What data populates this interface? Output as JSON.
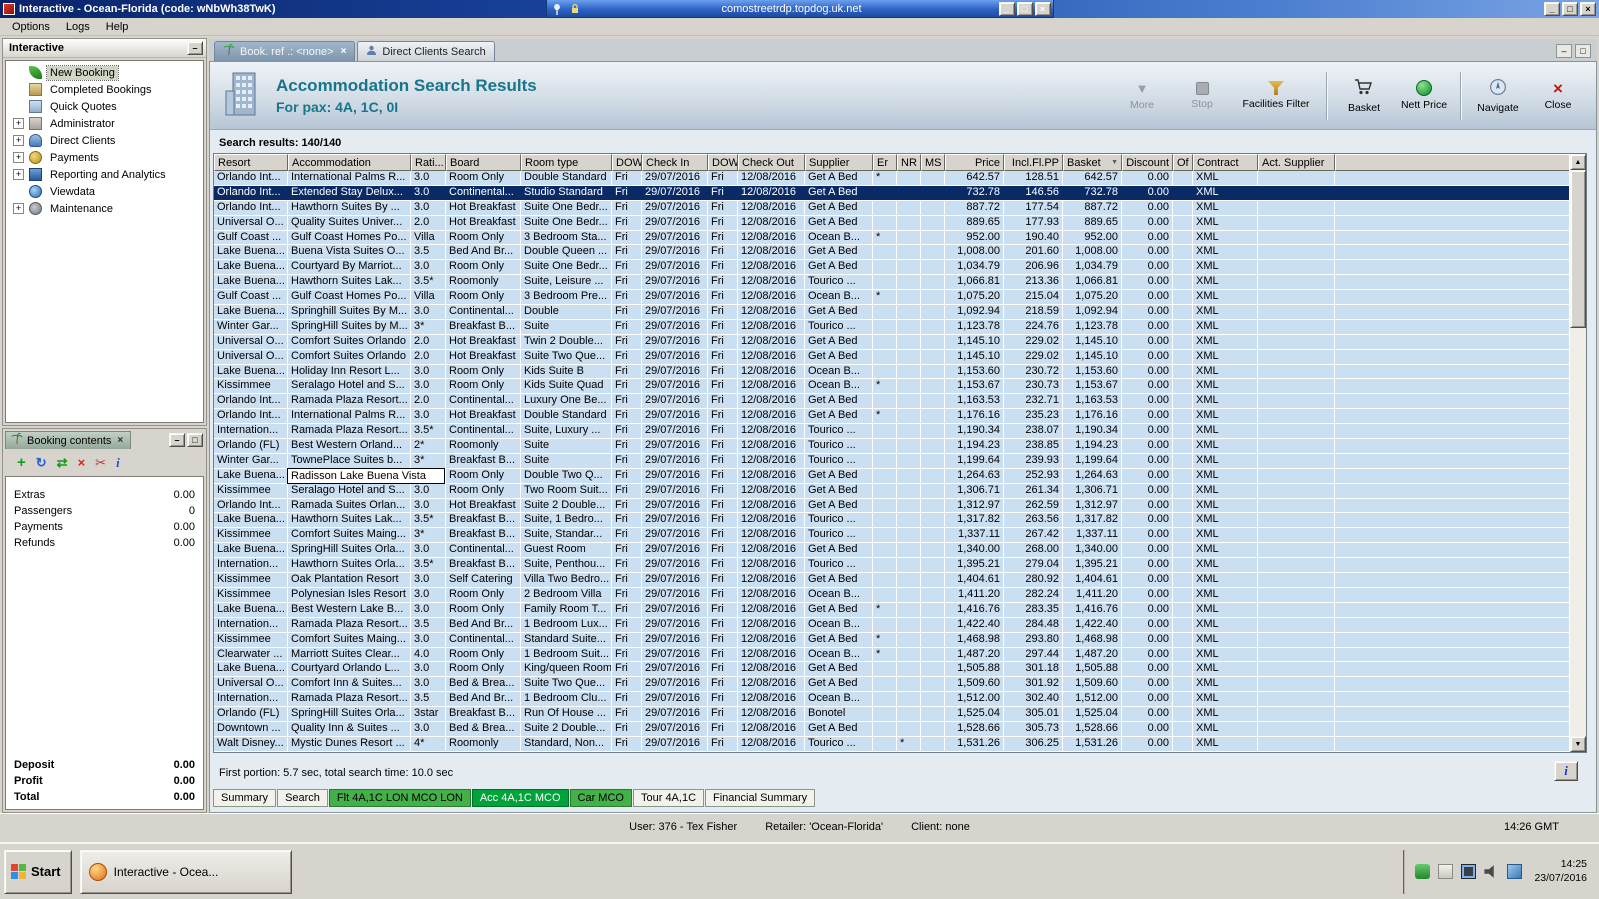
{
  "icons": {
    "minimize": "_",
    "maximize": "□",
    "close": "×",
    "collapse": "–",
    "expand": "+",
    "sort": "▼",
    "more": "▼",
    "up": "▲",
    "down": "▼",
    "plus": "+",
    "refresh": "↻",
    "transfer": "⇄",
    "delete": "×",
    "cut": "✂",
    "info": "i"
  },
  "rdp": {
    "host": "comostreetrdp.topdog.uk.net"
  },
  "window": {
    "title": "Interactive - Ocean-Florida (code: wNbWh38TwK)"
  },
  "menu": {
    "items": [
      "Options",
      "Logs",
      "Help"
    ]
  },
  "sidebar": {
    "title": "Interactive",
    "items": [
      {
        "label": "New Booking",
        "selected": true
      },
      {
        "label": "Completed Bookings"
      },
      {
        "label": "Quick Quotes"
      },
      {
        "label": "Administrator",
        "expandable": true
      },
      {
        "label": "Direct Clients",
        "expandable": true
      },
      {
        "label": "Payments",
        "expandable": true
      },
      {
        "label": "Reporting and Analytics",
        "expandable": true
      },
      {
        "label": "Viewdata"
      },
      {
        "label": "Maintenance",
        "expandable": true
      }
    ]
  },
  "booking_contents": {
    "title": "Booking contents",
    "rows": [
      {
        "label": "Extras",
        "value": "0.00"
      },
      {
        "label": "Passengers",
        "value": "0"
      },
      {
        "label": "Payments",
        "value": "0.00"
      },
      {
        "label": "Refunds",
        "value": "0.00"
      }
    ],
    "totals": [
      {
        "label": "Deposit",
        "value": "0.00"
      },
      {
        "label": "Profit",
        "value": "0.00"
      },
      {
        "label": "Total",
        "value": "0.00"
      }
    ]
  },
  "tabs": [
    {
      "label": "Book. ref .: <none>",
      "active": true
    },
    {
      "label": "Direct Clients Search",
      "active": false
    }
  ],
  "header": {
    "title": "Accommodation Search Results",
    "subtitle": "For pax: 4A, 1C, 0I",
    "buttons": [
      "More",
      "Stop",
      "Facilities Filter",
      "Basket",
      "Nett Price",
      "Navigate",
      "Close"
    ]
  },
  "results": {
    "summary": "Search results: 140/140",
    "footer": "First portion: 5.7 sec, total search time: 10.0 sec",
    "selected_index": 1,
    "edit_row_index": 20,
    "columns": [
      "Resort",
      "Accommodation",
      "Rati...",
      "Board",
      "Room type",
      "DOW",
      "Check In",
      "DOW",
      "Check Out",
      "Supplier",
      "Er",
      "NR",
      "MS",
      "Price",
      "Incl.Fl.PP",
      "Basket",
      "Discount",
      "Of",
      "Contract",
      "Act. Supplier"
    ],
    "rows": [
      [
        "Orlando Int...",
        "International Palms R...",
        "3.0",
        "Room Only",
        "Double Standard",
        "Fri",
        "29/07/2016",
        "Fri",
        "12/08/2016",
        "Get A Bed",
        "*",
        "",
        "",
        "642.57",
        "128.51",
        "642.57",
        "0.00",
        "",
        "XML",
        ""
      ],
      [
        "Orlando Int...",
        "Extended Stay Delux...",
        "3.0",
        "Continental...",
        "Studio Standard",
        "Fri",
        "29/07/2016",
        "Fri",
        "12/08/2016",
        "Get A Bed",
        "",
        "",
        "",
        "732.78",
        "146.56",
        "732.78",
        "0.00",
        "",
        "XML",
        ""
      ],
      [
        "Orlando Int...",
        "Hawthorn Suites By ...",
        "3.0",
        "Hot Breakfast",
        "Suite One Bedr...",
        "Fri",
        "29/07/2016",
        "Fri",
        "12/08/2016",
        "Get A Bed",
        "",
        "",
        "",
        "887.72",
        "177.54",
        "887.72",
        "0.00",
        "",
        "XML",
        ""
      ],
      [
        "Universal O...",
        "Quality Suites Univer...",
        "2.0",
        "Hot Breakfast",
        "Suite One Bedr...",
        "Fri",
        "29/07/2016",
        "Fri",
        "12/08/2016",
        "Get A Bed",
        "",
        "",
        "",
        "889.65",
        "177.93",
        "889.65",
        "0.00",
        "",
        "XML",
        ""
      ],
      [
        "Gulf Coast ...",
        "Gulf Coast Homes Po...",
        "Villa",
        "Room Only",
        "3 Bedroom Sta...",
        "Fri",
        "29/07/2016",
        "Fri",
        "12/08/2016",
        "Ocean B...",
        "*",
        "",
        "",
        "952.00",
        "190.40",
        "952.00",
        "0.00",
        "",
        "XML",
        ""
      ],
      [
        "Lake Buena...",
        "Buena Vista Suites O...",
        "3.5",
        "Bed And Br...",
        "Double Queen ...",
        "Fri",
        "29/07/2016",
        "Fri",
        "12/08/2016",
        "Get A Bed",
        "",
        "",
        "",
        "1,008.00",
        "201.60",
        "1,008.00",
        "0.00",
        "",
        "XML",
        ""
      ],
      [
        "Lake Buena...",
        "Courtyard By Marriot...",
        "3.0",
        "Room Only",
        "Suite One Bedr...",
        "Fri",
        "29/07/2016",
        "Fri",
        "12/08/2016",
        "Get A Bed",
        "",
        "",
        "",
        "1,034.79",
        "206.96",
        "1,034.79",
        "0.00",
        "",
        "XML",
        ""
      ],
      [
        "Lake Buena...",
        "Hawthorn Suites Lak...",
        "3.5*",
        "Roomonly",
        "Suite, Leisure ...",
        "Fri",
        "29/07/2016",
        "Fri",
        "12/08/2016",
        "Tourico ...",
        "",
        "",
        "",
        "1,066.81",
        "213.36",
        "1,066.81",
        "0.00",
        "",
        "XML",
        ""
      ],
      [
        "Gulf Coast ...",
        "Gulf Coast Homes Po...",
        "Villa",
        "Room Only",
        "3 Bedroom Pre...",
        "Fri",
        "29/07/2016",
        "Fri",
        "12/08/2016",
        "Ocean B...",
        "*",
        "",
        "",
        "1,075.20",
        "215.04",
        "1,075.20",
        "0.00",
        "",
        "XML",
        ""
      ],
      [
        "Lake Buena...",
        "Springhill Suites By M...",
        "3.0",
        "Continental...",
        "Double",
        "Fri",
        "29/07/2016",
        "Fri",
        "12/08/2016",
        "Get A Bed",
        "",
        "",
        "",
        "1,092.94",
        "218.59",
        "1,092.94",
        "0.00",
        "",
        "XML",
        ""
      ],
      [
        "Winter Gar...",
        "SpringHill Suites by M...",
        "3*",
        "Breakfast B...",
        "Suite",
        "Fri",
        "29/07/2016",
        "Fri",
        "12/08/2016",
        "Tourico ...",
        "",
        "",
        "",
        "1,123.78",
        "224.76",
        "1,123.78",
        "0.00",
        "",
        "XML",
        ""
      ],
      [
        "Universal O...",
        "Comfort Suites Orlando",
        "2.0",
        "Hot Breakfast",
        "Twin 2 Double...",
        "Fri",
        "29/07/2016",
        "Fri",
        "12/08/2016",
        "Get A Bed",
        "",
        "",
        "",
        "1,145.10",
        "229.02",
        "1,145.10",
        "0.00",
        "",
        "XML",
        ""
      ],
      [
        "Universal O...",
        "Comfort Suites Orlando",
        "2.0",
        "Hot Breakfast",
        "Suite Two Que...",
        "Fri",
        "29/07/2016",
        "Fri",
        "12/08/2016",
        "Get A Bed",
        "",
        "",
        "",
        "1,145.10",
        "229.02",
        "1,145.10",
        "0.00",
        "",
        "XML",
        ""
      ],
      [
        "Lake Buena...",
        "Holiday Inn Resort L...",
        "3.0",
        "Room Only",
        "Kids Suite B",
        "Fri",
        "29/07/2016",
        "Fri",
        "12/08/2016",
        "Ocean B...",
        "",
        "",
        "",
        "1,153.60",
        "230.72",
        "1,153.60",
        "0.00",
        "",
        "XML",
        ""
      ],
      [
        "Kissimmee",
        "Seralago Hotel and S...",
        "3.0",
        "Room Only",
        "Kids Suite Quad",
        "Fri",
        "29/07/2016",
        "Fri",
        "12/08/2016",
        "Ocean B...",
        "*",
        "",
        "",
        "1,153.67",
        "230.73",
        "1,153.67",
        "0.00",
        "",
        "XML",
        ""
      ],
      [
        "Orlando Int...",
        "Ramada Plaza Resort...",
        "2.0",
        "Continental...",
        "Luxury One Be...",
        "Fri",
        "29/07/2016",
        "Fri",
        "12/08/2016",
        "Get A Bed",
        "",
        "",
        "",
        "1,163.53",
        "232.71",
        "1,163.53",
        "0.00",
        "",
        "XML",
        ""
      ],
      [
        "Orlando Int...",
        "International Palms R...",
        "3.0",
        "Hot Breakfast",
        "Double Standard",
        "Fri",
        "29/07/2016",
        "Fri",
        "12/08/2016",
        "Get A Bed",
        "*",
        "",
        "",
        "1,176.16",
        "235.23",
        "1,176.16",
        "0.00",
        "",
        "XML",
        ""
      ],
      [
        "Internation...",
        "Ramada Plaza Resort...",
        "3.5*",
        "Continental...",
        "Suite, Luxury ...",
        "Fri",
        "29/07/2016",
        "Fri",
        "12/08/2016",
        "Tourico ...",
        "",
        "",
        "",
        "1,190.34",
        "238.07",
        "1,190.34",
        "0.00",
        "",
        "XML",
        ""
      ],
      [
        "Orlando (FL)",
        "Best Western Orland...",
        "2*",
        "Roomonly",
        "Suite",
        "Fri",
        "29/07/2016",
        "Fri",
        "12/08/2016",
        "Tourico ...",
        "",
        "",
        "",
        "1,194.23",
        "238.85",
        "1,194.23",
        "0.00",
        "",
        "XML",
        ""
      ],
      [
        "Winter Gar...",
        "TownePlace Suites b...",
        "3*",
        "Breakfast B...",
        "Suite",
        "Fri",
        "29/07/2016",
        "Fri",
        "12/08/2016",
        "Tourico ...",
        "",
        "",
        "",
        "1,199.64",
        "239.93",
        "1,199.64",
        "0.00",
        "",
        "XML",
        ""
      ],
      [
        "Lake Buena...",
        "Radisson Lake Buena Vista",
        "",
        "Room Only",
        "Double Two Q...",
        "Fri",
        "29/07/2016",
        "Fri",
        "12/08/2016",
        "Get A Bed",
        "",
        "",
        "",
        "1,264.63",
        "252.93",
        "1,264.63",
        "0.00",
        "",
        "XML",
        ""
      ],
      [
        "Kissimmee",
        "Seralago Hotel and S...",
        "3.0",
        "Room Only",
        "Two Room Suit...",
        "Fri",
        "29/07/2016",
        "Fri",
        "12/08/2016",
        "Get A Bed",
        "",
        "",
        "",
        "1,306.71",
        "261.34",
        "1,306.71",
        "0.00",
        "",
        "XML",
        ""
      ],
      [
        "Orlando Int...",
        "Ramada Suites Orlan...",
        "3.0",
        "Hot Breakfast",
        "Suite 2 Double...",
        "Fri",
        "29/07/2016",
        "Fri",
        "12/08/2016",
        "Get A Bed",
        "",
        "",
        "",
        "1,312.97",
        "262.59",
        "1,312.97",
        "0.00",
        "",
        "XML",
        ""
      ],
      [
        "Lake Buena...",
        "Hawthorn Suites Lak...",
        "3.5*",
        "Breakfast B...",
        "Suite, 1 Bedro...",
        "Fri",
        "29/07/2016",
        "Fri",
        "12/08/2016",
        "Tourico ...",
        "",
        "",
        "",
        "1,317.82",
        "263.56",
        "1,317.82",
        "0.00",
        "",
        "XML",
        ""
      ],
      [
        "Kissimmee",
        "Comfort Suites Maing...",
        "3*",
        "Breakfast B...",
        "Suite, Standar...",
        "Fri",
        "29/07/2016",
        "Fri",
        "12/08/2016",
        "Tourico ...",
        "",
        "",
        "",
        "1,337.11",
        "267.42",
        "1,337.11",
        "0.00",
        "",
        "XML",
        ""
      ],
      [
        "Lake Buena...",
        "SpringHill Suites Orla...",
        "3.0",
        "Continental...",
        "Guest Room",
        "Fri",
        "29/07/2016",
        "Fri",
        "12/08/2016",
        "Get A Bed",
        "",
        "",
        "",
        "1,340.00",
        "268.00",
        "1,340.00",
        "0.00",
        "",
        "XML",
        ""
      ],
      [
        "Internation...",
        "Hawthorn Suites Orla...",
        "3.5*",
        "Breakfast B...",
        "Suite, Penthou...",
        "Fri",
        "29/07/2016",
        "Fri",
        "12/08/2016",
        "Tourico ...",
        "",
        "",
        "",
        "1,395.21",
        "279.04",
        "1,395.21",
        "0.00",
        "",
        "XML",
        ""
      ],
      [
        "Kissimmee",
        "Oak Plantation Resort",
        "3.0",
        "Self Catering",
        "Villa Two Bedro...",
        "Fri",
        "29/07/2016",
        "Fri",
        "12/08/2016",
        "Get A Bed",
        "",
        "",
        "",
        "1,404.61",
        "280.92",
        "1,404.61",
        "0.00",
        "",
        "XML",
        ""
      ],
      [
        "Kissimmee",
        "Polynesian Isles Resort",
        "3.0",
        "Room Only",
        "2 Bedroom Villa",
        "Fri",
        "29/07/2016",
        "Fri",
        "12/08/2016",
        "Ocean B...",
        "",
        "",
        "",
        "1,411.20",
        "282.24",
        "1,411.20",
        "0.00",
        "",
        "XML",
        ""
      ],
      [
        "Lake Buena...",
        "Best Western Lake B...",
        "3.0",
        "Room Only",
        "Family Room T...",
        "Fri",
        "29/07/2016",
        "Fri",
        "12/08/2016",
        "Get A Bed",
        "*",
        "",
        "",
        "1,416.76",
        "283.35",
        "1,416.76",
        "0.00",
        "",
        "XML",
        ""
      ],
      [
        "Internation...",
        "Ramada Plaza Resort...",
        "3.5",
        "Bed And Br...",
        "1 Bedroom Lux...",
        "Fri",
        "29/07/2016",
        "Fri",
        "12/08/2016",
        "Ocean B...",
        "",
        "",
        "",
        "1,422.40",
        "284.48",
        "1,422.40",
        "0.00",
        "",
        "XML",
        ""
      ],
      [
        "Kissimmee",
        "Comfort Suites Maing...",
        "3.0",
        "Continental...",
        "Standard Suite...",
        "Fri",
        "29/07/2016",
        "Fri",
        "12/08/2016",
        "Get A Bed",
        "*",
        "",
        "",
        "1,468.98",
        "293.80",
        "1,468.98",
        "0.00",
        "",
        "XML",
        ""
      ],
      [
        "Clearwater ...",
        "Marriott Suites Clear...",
        "4.0",
        "Room Only",
        "1 Bedroom Suit...",
        "Fri",
        "29/07/2016",
        "Fri",
        "12/08/2016",
        "Ocean B...",
        "*",
        "",
        "",
        "1,487.20",
        "297.44",
        "1,487.20",
        "0.00",
        "",
        "XML",
        ""
      ],
      [
        "Lake Buena...",
        "Courtyard Orlando L...",
        "3.0",
        "Room Only",
        "King/queen Room",
        "Fri",
        "29/07/2016",
        "Fri",
        "12/08/2016",
        "Get A Bed",
        "",
        "",
        "",
        "1,505.88",
        "301.18",
        "1,505.88",
        "0.00",
        "",
        "XML",
        ""
      ],
      [
        "Universal O...",
        "Comfort Inn & Suites...",
        "3.0",
        "Bed & Brea...",
        "Suite Two Que...",
        "Fri",
        "29/07/2016",
        "Fri",
        "12/08/2016",
        "Get A Bed",
        "",
        "",
        "",
        "1,509.60",
        "301.92",
        "1,509.60",
        "0.00",
        "",
        "XML",
        ""
      ],
      [
        "Internation...",
        "Ramada Plaza Resort...",
        "3.5",
        "Bed And Br...",
        "1 Bedroom Clu...",
        "Fri",
        "29/07/2016",
        "Fri",
        "12/08/2016",
        "Ocean B...",
        "",
        "",
        "",
        "1,512.00",
        "302.40",
        "1,512.00",
        "0.00",
        "",
        "XML",
        ""
      ],
      [
        "Orlando (FL)",
        "SpringHill Suites Orla...",
        "3star",
        "Breakfast B...",
        "Run Of House ...",
        "Fri",
        "29/07/2016",
        "Fri",
        "12/08/2016",
        "Bonotel",
        "",
        "",
        "",
        "1,525.04",
        "305.01",
        "1,525.04",
        "0.00",
        "",
        "XML",
        ""
      ],
      [
        "Downtown ...",
        "Quality Inn & Suites ...",
        "3.0",
        "Bed & Brea...",
        "Suite 2 Double...",
        "Fri",
        "29/07/2016",
        "Fri",
        "12/08/2016",
        "Get A Bed",
        "",
        "",
        "",
        "1,528.66",
        "305.73",
        "1,528.66",
        "0.00",
        "",
        "XML",
        ""
      ],
      [
        "Walt Disney...",
        "Mystic Dunes Resort ...",
        "4*",
        "Roomonly",
        "Standard, Non...",
        "Fri",
        "29/07/2016",
        "Fri",
        "12/08/2016",
        "Tourico ...",
        "",
        "*",
        "",
        "1,531.26",
        "306.25",
        "1,531.26",
        "0.00",
        "",
        "XML",
        ""
      ]
    ]
  },
  "bottom_tabs": [
    {
      "label": "Summary",
      "style": "plain"
    },
    {
      "label": "Search",
      "style": "plain"
    },
    {
      "label": "Flt 4A,1C LON MCO LON",
      "style": "green"
    },
    {
      "label": "Acc 4A,1C MCO",
      "style": "green-active",
      "active": true
    },
    {
      "label": "Car MCO",
      "style": "green"
    },
    {
      "label": "Tour 4A,1C",
      "style": "plain"
    },
    {
      "label": "Financial Summary",
      "style": "plain"
    }
  ],
  "status_bar": {
    "user": "User: 376 - Tex Fisher",
    "retailer": "Retailer: 'Ocean-Florida'",
    "client": "Client: none",
    "time": "14:26 GMT"
  },
  "taskbar": {
    "start": "Start",
    "task": "Interactive - Ocea...",
    "time": "14:25",
    "date": "23/07/2016"
  },
  "colors": {
    "selection": "#0a2a66",
    "row_blue": "#cbdff2",
    "green_tab": "#43b049",
    "green_tab_active": "#00a33a",
    "title_teal": "#19758a"
  }
}
